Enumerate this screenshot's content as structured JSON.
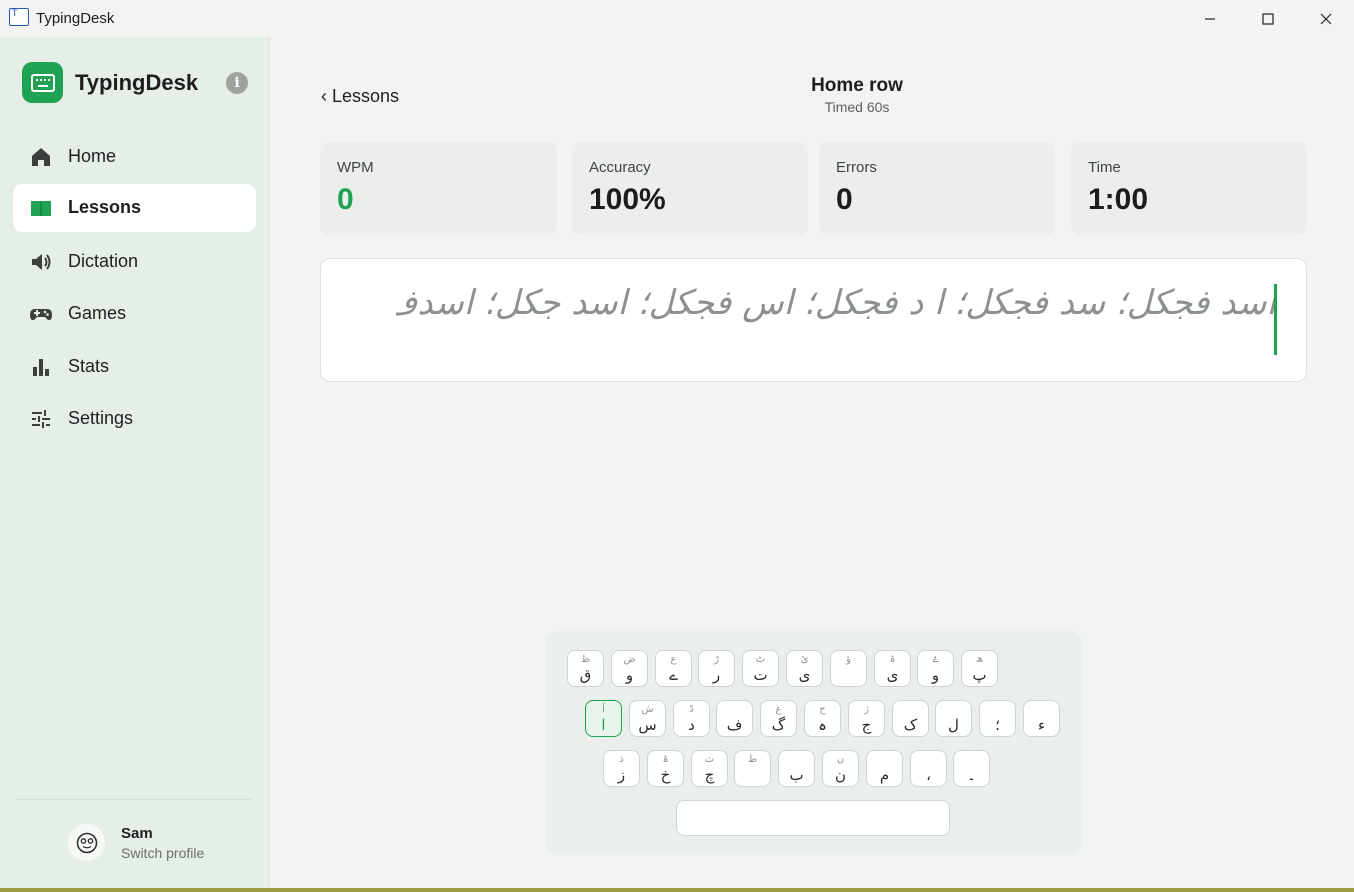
{
  "window": {
    "title": "TypingDesk"
  },
  "sidebar": {
    "brand": "TypingDesk",
    "items": [
      {
        "label": "Home",
        "icon": "home-icon",
        "active": false
      },
      {
        "label": "Lessons",
        "icon": "book-icon",
        "active": true
      },
      {
        "label": "Dictation",
        "icon": "speaker-icon",
        "active": false
      },
      {
        "label": "Games",
        "icon": "gamepad-icon",
        "active": false
      },
      {
        "label": "Stats",
        "icon": "bar-chart-icon",
        "active": false
      },
      {
        "label": "Settings",
        "icon": "sliders-icon",
        "active": false
      }
    ],
    "profile": {
      "name": "Sam",
      "action": "Switch profile"
    }
  },
  "header": {
    "back_label": "‹ Lessons",
    "title": "Home row",
    "subtitle": "Timed 60s"
  },
  "stats": [
    {
      "label": "WPM",
      "value": "0"
    },
    {
      "label": "Accuracy",
      "value": "100%"
    },
    {
      "label": "Errors",
      "value": "0"
    },
    {
      "label": "Time",
      "value": "1:00"
    }
  ],
  "practice_text": "اسد فجکل؛ سد فجکل؛ ا د فجکل؛ اس فجکل؛ اسد جکل؛ اسدف کل؛ اسدفج ل؛ اسد فجک ؛ اسد فجکل",
  "keyboard": {
    "rows": [
      [
        {
          "main": "ق",
          "shift": "ظ"
        },
        {
          "main": "و",
          "shift": "ض"
        },
        {
          "main": "ے",
          "shift": "ع"
        },
        {
          "main": "ر",
          "shift": "ڑ"
        },
        {
          "main": "ت",
          "shift": "ٹ"
        },
        {
          "main": "ی",
          "shift": "ئ"
        },
        {
          "main": "",
          "shift": "ؤ"
        },
        {
          "main": "ی",
          "shift": "ۃ"
        },
        {
          "main": "و",
          "shift": "ۓ"
        },
        {
          "main": "پ",
          "shift": "ھ"
        }
      ],
      [
        {
          "main": "ا",
          "shift": "آ",
          "home": true
        },
        {
          "main": "س",
          "shift": "ش"
        },
        {
          "main": "د",
          "shift": "ڈ"
        },
        {
          "main": "ف",
          "shift": ""
        },
        {
          "main": "گ",
          "shift": "غ"
        },
        {
          "main": "ہ",
          "shift": "ح"
        },
        {
          "main": "ج",
          "shift": "ژ"
        },
        {
          "main": "ک",
          "shift": ""
        },
        {
          "main": "ل",
          "shift": ""
        },
        {
          "main": "؛",
          "shift": ""
        },
        {
          "main": "ء",
          "shift": ""
        }
      ],
      [
        {
          "main": "ز",
          "shift": "ذ"
        },
        {
          "main": "خ",
          "shift": "ۂ"
        },
        {
          "main": "چ",
          "shift": "ث"
        },
        {
          "main": "",
          "shift": "ط"
        },
        {
          "main": "ب",
          "shift": ""
        },
        {
          "main": "ن",
          "shift": "ں"
        },
        {
          "main": "م",
          "shift": ""
        },
        {
          "main": "،",
          "shift": ""
        },
        {
          "main": "۔",
          "shift": ""
        }
      ]
    ]
  }
}
